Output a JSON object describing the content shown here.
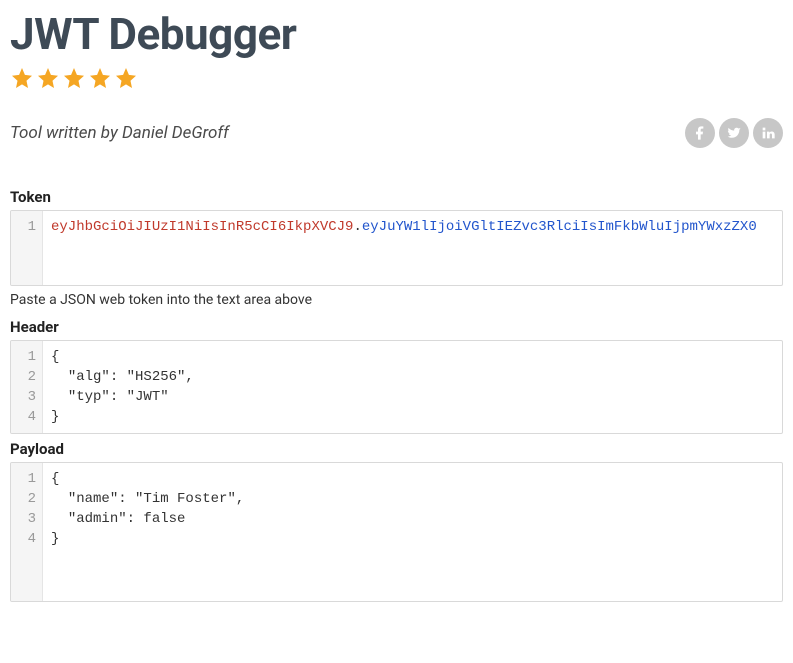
{
  "title": "JWT Debugger",
  "rating": 5,
  "byline": "Tool written by Daniel DeGroff",
  "labels": {
    "token": "Token",
    "header": "Header",
    "payload": "Payload"
  },
  "token": {
    "header": "eyJhbGciOiJIUzI1NiIsInR5cCI6IkpXVCJ9",
    "payload": "eyJuYW1lIjoiVGltIEZvc3RlciIsImFkbWluIjpmYWxzZX0"
  },
  "token_helper": "Paste a JSON web token into the text area above",
  "header_json": {
    "lines": [
      "{",
      "  \"alg\": \"HS256\",",
      "  \"typ\": \"JWT\"",
      "}"
    ]
  },
  "payload_json": {
    "lines": [
      "{",
      "  \"name\": \"Tim Foster\",",
      "  \"admin\": false",
      "}"
    ]
  }
}
